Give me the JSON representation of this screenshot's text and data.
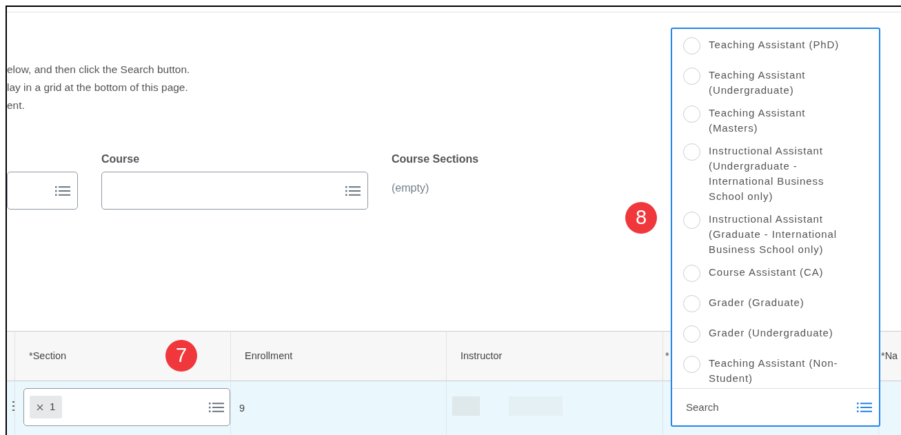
{
  "intro_lines": [
    "elow, and then click the Search button.",
    "lay in a grid at the bottom of this page.",
    "ent."
  ],
  "filters": [
    {
      "kind": "prompt"
    },
    {
      "kind": "prompt",
      "label": "Course"
    },
    {
      "kind": "text",
      "label": "Course Sections",
      "value": "(empty)"
    }
  ],
  "table": {
    "columns": [
      {
        "label": "*Section",
        "callout": "7"
      },
      {
        "label": "Enrollment"
      },
      {
        "label": "Instructor"
      },
      {
        "label": "*"
      },
      {
        "label": "*Na"
      }
    ],
    "rows": [
      {
        "section_tags": [
          "1"
        ],
        "enrollment": "9"
      }
    ]
  },
  "dropdown": {
    "callout": "8",
    "options": [
      {
        "label": "Teaching Assistant (PhD)",
        "selected": false
      },
      {
        "label": "Teaching Assistant (Undergraduate)",
        "selected": false
      },
      {
        "label": "Teaching Assistant (Masters)",
        "selected": false
      },
      {
        "label": "Instructional Assistant (Undergraduate - International Business School only)",
        "selected": false
      },
      {
        "label": "Instructional Assistant (Graduate - International Business School only)",
        "selected": false
      },
      {
        "label": "Course Assistant (CA)",
        "selected": false
      },
      {
        "label": "Grader (Graduate)",
        "selected": false
      },
      {
        "label": "Grader (Undergraduate)",
        "selected": false
      },
      {
        "label": "Teaching Assistant (Non-Student)",
        "selected": false
      }
    ],
    "search": {
      "placeholder": "Search"
    }
  }
}
